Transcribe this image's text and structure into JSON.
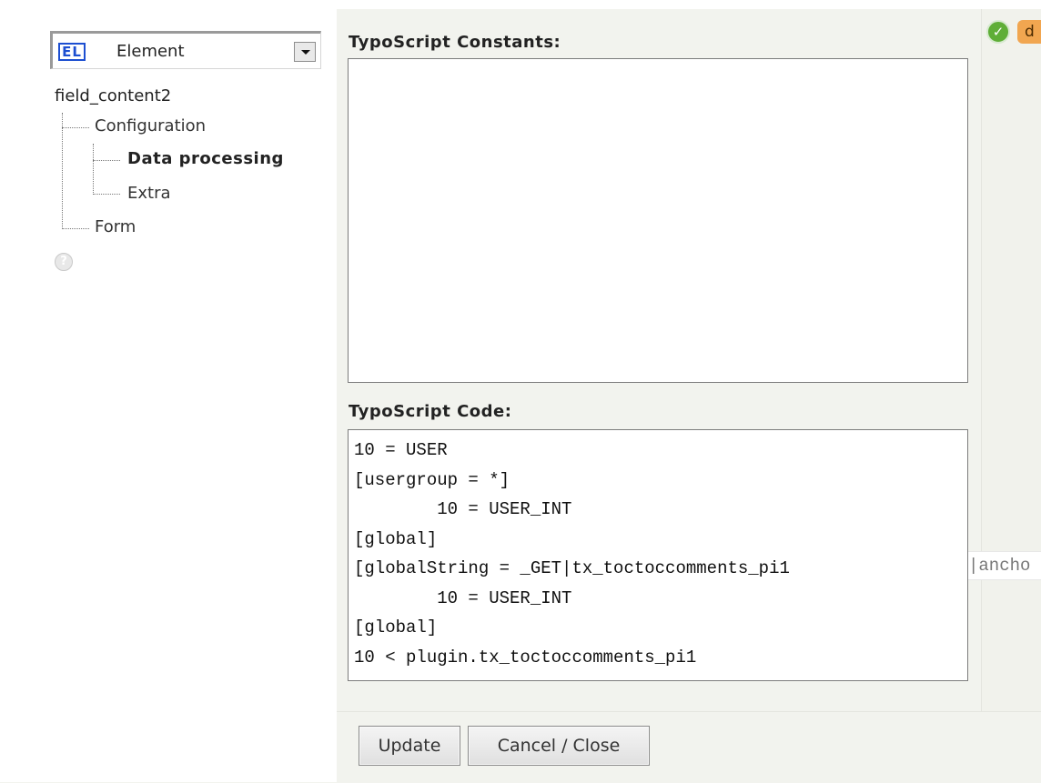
{
  "element_selector": {
    "badge": "EL",
    "label": "Element"
  },
  "tree": {
    "root": "field_content2",
    "items": [
      {
        "label": "Configuration"
      },
      {
        "label": "Data processing",
        "active": true
      },
      {
        "label": "Extra"
      },
      {
        "label": "Form"
      }
    ]
  },
  "help_icon": "help-icon",
  "status": {
    "ok_icon": "checkmark",
    "tag_text": "d"
  },
  "constants": {
    "label": "TypoScript Constants:",
    "value": ""
  },
  "code": {
    "label": "TypoScript Code:",
    "value": "10 = USER\n[usergroup = *]\n        10 = USER_INT\n[global]\n[globalString = _GET|tx_toctoccomments_pi1\n        10 = USER_INT\n[global]\n10 < plugin.tx_toctoccomments_pi1",
    "overflow": "|ancho"
  },
  "buttons": {
    "update": "Update",
    "cancel": "Cancel / Close"
  }
}
